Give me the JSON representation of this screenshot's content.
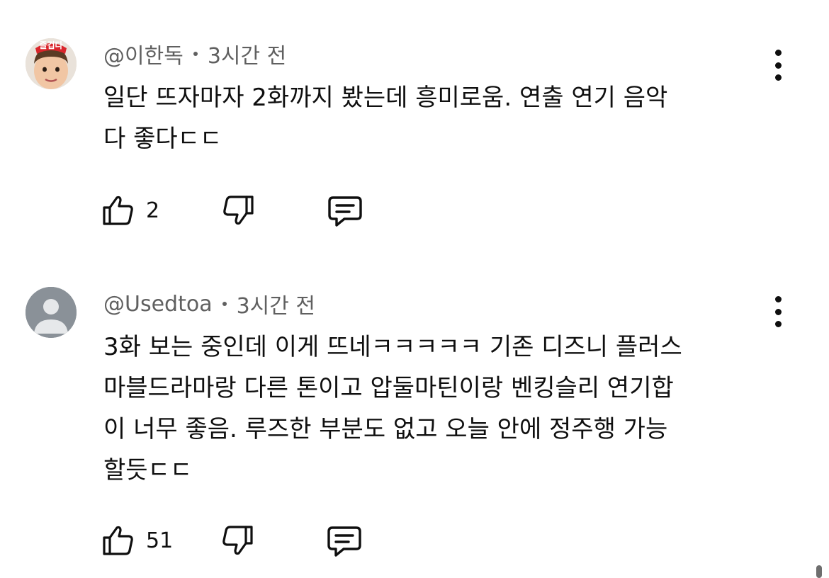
{
  "comments": [
    {
      "author": "@이한독",
      "time": "3시간 전",
      "avatar_badge": "즐겁다",
      "lines": [
        "일단 뜨자마자 2화까지 봤는데 흥미로움. 연출 연기 음악",
        "다 좋다ㄷㄷ"
      ],
      "likes": "2",
      "icons": {
        "more": "more-vert-icon",
        "like": "thumbs-up-icon",
        "dislike": "thumbs-down-icon",
        "reply": "reply-comment-icon"
      }
    },
    {
      "author": "@Usedtoa",
      "time": "3시간 전",
      "lines": [
        "3화 보는 중인데 이게 뜨네ㅋㅋㅋㅋㅋ 기존 디즈니 플러스",
        "마블드라마랑 다른 톤이고 압둘마틴이랑 벤킹슬리 연기합",
        "이 너무 좋음. 루즈한 부분도 없고 오늘 안에 정주행 가능",
        "할듯ㄷㄷ"
      ],
      "likes": "51",
      "icons": {
        "more": "more-vert-icon",
        "like": "thumbs-up-icon",
        "dislike": "thumbs-down-icon",
        "reply": "reply-comment-icon"
      }
    }
  ],
  "colors": {
    "text": "#0f0f0f",
    "meta": "#606060",
    "badge": "#d9252b",
    "default_avatar_bg": "#8a9198"
  }
}
